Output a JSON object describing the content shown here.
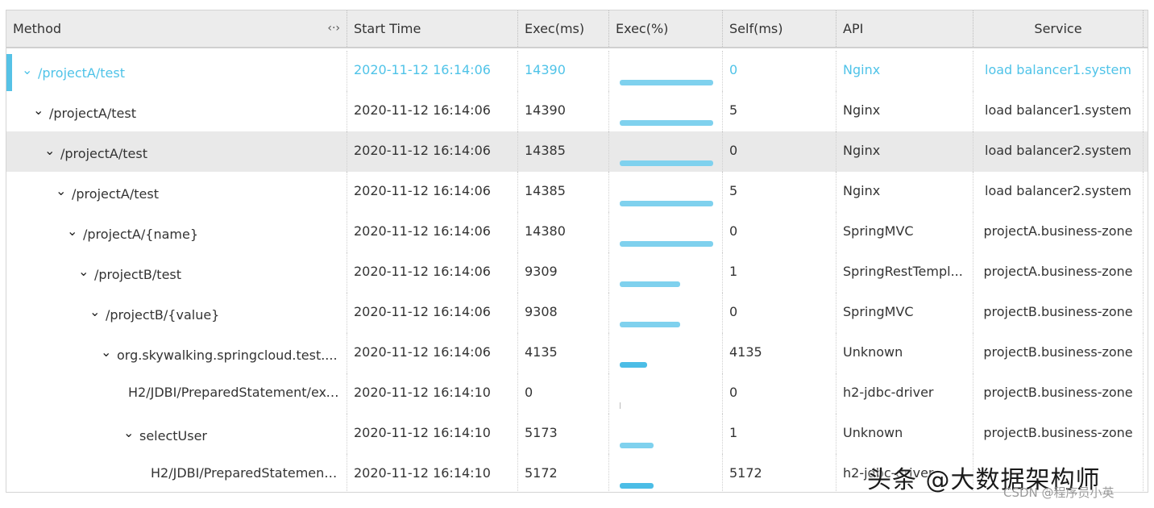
{
  "columns": {
    "method": "Method",
    "resize_glyph": "‹·›",
    "start_time": "Start Time",
    "exec_ms": "Exec(ms)",
    "exec_pct": "Exec(%)",
    "self_ms": "Self(ms)",
    "api": "API",
    "service": "Service"
  },
  "rows": [
    {
      "method": "/projectA/test",
      "has_children": true,
      "start": "2020-11-12 16:14:06",
      "exec": "14390",
      "pct": 1.0,
      "self": "0",
      "api": "Nginx",
      "service": "load balancer1.system",
      "selected": true
    },
    {
      "method": "/projectA/test",
      "has_children": true,
      "start": "2020-11-12 16:14:06",
      "exec": "14390",
      "pct": 1.0,
      "self": "5",
      "api": "Nginx",
      "service": "load balancer1.system"
    },
    {
      "method": "/projectA/test",
      "has_children": true,
      "start": "2020-11-12 16:14:06",
      "exec": "14385",
      "pct": 1.0,
      "self": "0",
      "api": "Nginx",
      "service": "load balancer2.system",
      "highlighted": true
    },
    {
      "method": "/projectA/test",
      "has_children": true,
      "start": "2020-11-12 16:14:06",
      "exec": "14385",
      "pct": 1.0,
      "self": "5",
      "api": "Nginx",
      "service": "load balancer2.system"
    },
    {
      "method": "/projectA/{name}",
      "has_children": true,
      "start": "2020-11-12 16:14:06",
      "exec": "14380",
      "pct": 1.0,
      "self": "0",
      "api": "SpringMVC",
      "service": "projectA.business-zone"
    },
    {
      "method": "/projectB/test",
      "has_children": true,
      "start": "2020-11-12 16:14:06",
      "exec": "9309",
      "pct": 0.65,
      "self": "1",
      "api": "SpringRestTempl...",
      "service": "projectA.business-zone"
    },
    {
      "method": "/projectB/{value}",
      "has_children": true,
      "start": "2020-11-12 16:14:06",
      "exec": "9308",
      "pct": 0.65,
      "self": "0",
      "api": "SpringMVC",
      "service": "projectB.business-zone"
    },
    {
      "method": "org.skywalking.springcloud.test....",
      "has_children": true,
      "start": "2020-11-12 16:14:06",
      "exec": "4135",
      "pct": 0.29,
      "self": "4135",
      "api": "Unknown",
      "service": "projectB.business-zone",
      "dark": true
    },
    {
      "method": "H2/JDBI/PreparedStatement/exe...",
      "has_children": false,
      "start": "2020-11-12 16:14:10",
      "exec": "0",
      "pct": 0,
      "self": "0",
      "api": "h2-jdbc-driver",
      "service": "projectB.business-zone"
    },
    {
      "method": "selectUser",
      "has_children": true,
      "start": "2020-11-12 16:14:10",
      "exec": "5173",
      "pct": 0.36,
      "self": "1",
      "api": "Unknown",
      "service": "projectB.business-zone"
    },
    {
      "method": "H2/JDBI/PreparedStatement/exe...",
      "has_children": false,
      "start": "2020-11-12 16:14:10",
      "exec": "5172",
      "pct": 0.36,
      "self": "5172",
      "api": "h2-jdbc-driver",
      "service": "",
      "dark": true
    }
  ],
  "watermark": {
    "main": "头条 @大数据架构师",
    "sub": "CSDN @程序员小英"
  }
}
